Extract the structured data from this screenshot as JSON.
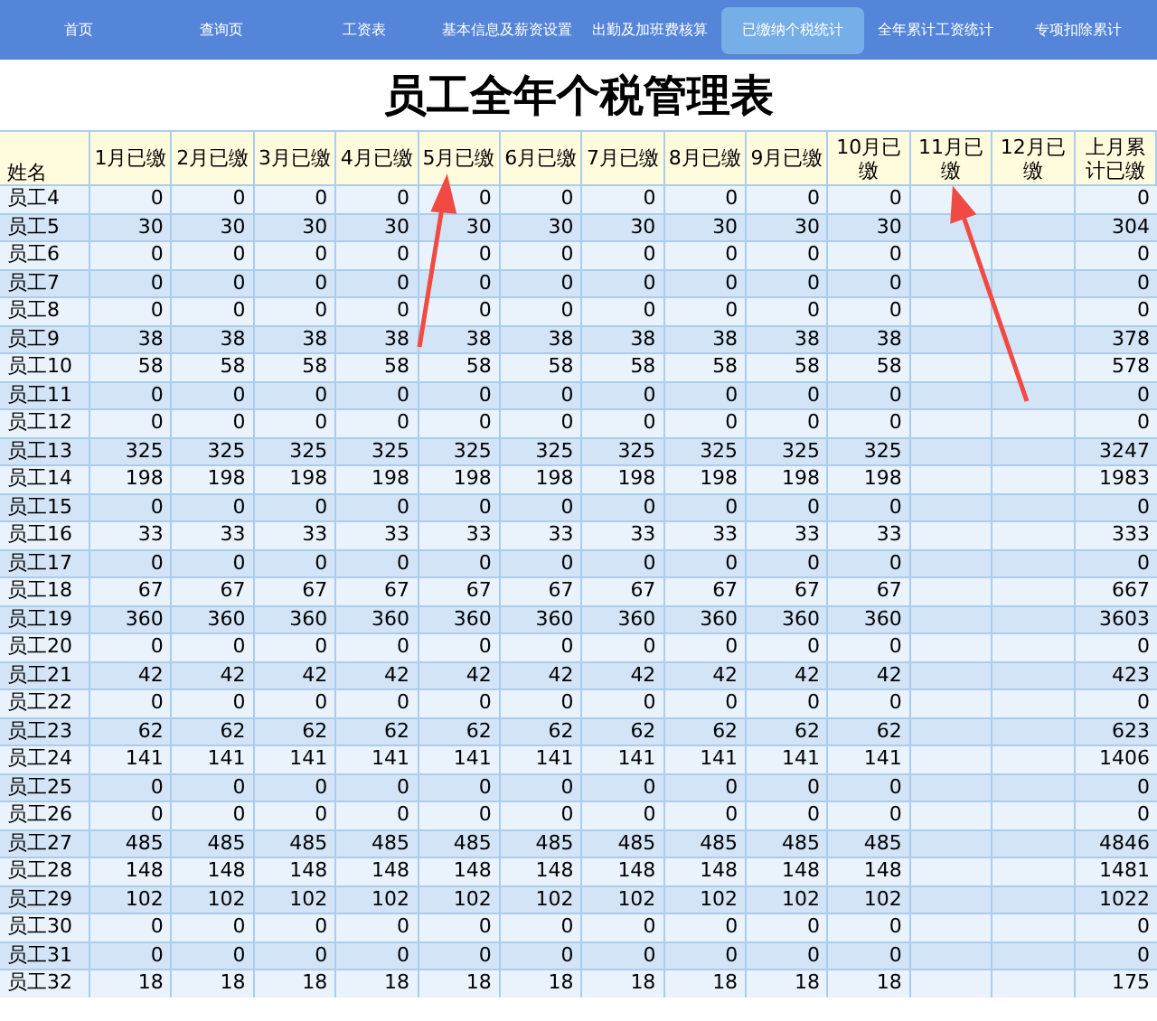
{
  "nav": [
    {
      "label": "首页",
      "selected": false
    },
    {
      "label": "查询页",
      "selected": false
    },
    {
      "label": "工资表",
      "selected": false
    },
    {
      "label": "基本信息及薪资设置",
      "selected": false
    },
    {
      "label": "出勤及加班费核算",
      "selected": false
    },
    {
      "label": "已缴纳个税统计",
      "selected": true
    },
    {
      "label": "全年累计工资统计",
      "selected": false
    },
    {
      "label": "专项扣除累计",
      "selected": false
    }
  ],
  "title": "员工全年个税管理表",
  "table": {
    "columns": [
      "姓名",
      "1月已缴",
      "2月已缴",
      "3月已缴",
      "4月已缴",
      "5月已缴",
      "6月已缴",
      "7月已缴",
      "8月已缴",
      "9月已缴",
      "10月已缴",
      "11月已缴",
      "12月已缴",
      "上月累计已缴"
    ],
    "rows": [
      {
        "name": "员工4",
        "paid": [
          "0",
          "0",
          "0",
          "0",
          "0",
          "0",
          "0",
          "0",
          "0",
          "0"
        ],
        "total": "0"
      },
      {
        "name": "员工5",
        "paid": [
          "30",
          "30",
          "30",
          "30",
          "30",
          "30",
          "30",
          "30",
          "30",
          "30"
        ],
        "total": "304"
      },
      {
        "name": "员工6",
        "paid": [
          "0",
          "0",
          "0",
          "0",
          "0",
          "0",
          "0",
          "0",
          "0",
          "0"
        ],
        "total": "0"
      },
      {
        "name": "员工7",
        "paid": [
          "0",
          "0",
          "0",
          "0",
          "0",
          "0",
          "0",
          "0",
          "0",
          "0"
        ],
        "total": "0"
      },
      {
        "name": "员工8",
        "paid": [
          "0",
          "0",
          "0",
          "0",
          "0",
          "0",
          "0",
          "0",
          "0",
          "0"
        ],
        "total": "0"
      },
      {
        "name": "员工9",
        "paid": [
          "38",
          "38",
          "38",
          "38",
          "38",
          "38",
          "38",
          "38",
          "38",
          "38"
        ],
        "total": "378"
      },
      {
        "name": "员工10",
        "paid": [
          "58",
          "58",
          "58",
          "58",
          "58",
          "58",
          "58",
          "58",
          "58",
          "58"
        ],
        "total": "578"
      },
      {
        "name": "员工11",
        "paid": [
          "0",
          "0",
          "0",
          "0",
          "0",
          "0",
          "0",
          "0",
          "0",
          "0"
        ],
        "total": "0"
      },
      {
        "name": "员工12",
        "paid": [
          "0",
          "0",
          "0",
          "0",
          "0",
          "0",
          "0",
          "0",
          "0",
          "0"
        ],
        "total": "0"
      },
      {
        "name": "员工13",
        "paid": [
          "325",
          "325",
          "325",
          "325",
          "325",
          "325",
          "325",
          "325",
          "325",
          "325"
        ],
        "total": "3247"
      },
      {
        "name": "员工14",
        "paid": [
          "198",
          "198",
          "198",
          "198",
          "198",
          "198",
          "198",
          "198",
          "198",
          "198"
        ],
        "total": "1983"
      },
      {
        "name": "员工15",
        "paid": [
          "0",
          "0",
          "0",
          "0",
          "0",
          "0",
          "0",
          "0",
          "0",
          "0"
        ],
        "total": "0"
      },
      {
        "name": "员工16",
        "paid": [
          "33",
          "33",
          "33",
          "33",
          "33",
          "33",
          "33",
          "33",
          "33",
          "33"
        ],
        "total": "333"
      },
      {
        "name": "员工17",
        "paid": [
          "0",
          "0",
          "0",
          "0",
          "0",
          "0",
          "0",
          "0",
          "0",
          "0"
        ],
        "total": "0"
      },
      {
        "name": "员工18",
        "paid": [
          "67",
          "67",
          "67",
          "67",
          "67",
          "67",
          "67",
          "67",
          "67",
          "67"
        ],
        "total": "667"
      },
      {
        "name": "员工19",
        "paid": [
          "360",
          "360",
          "360",
          "360",
          "360",
          "360",
          "360",
          "360",
          "360",
          "360"
        ],
        "total": "3603"
      },
      {
        "name": "员工20",
        "paid": [
          "0",
          "0",
          "0",
          "0",
          "0",
          "0",
          "0",
          "0",
          "0",
          "0"
        ],
        "total": "0"
      },
      {
        "name": "员工21",
        "paid": [
          "42",
          "42",
          "42",
          "42",
          "42",
          "42",
          "42",
          "42",
          "42",
          "42"
        ],
        "total": "423"
      },
      {
        "name": "员工22",
        "paid": [
          "0",
          "0",
          "0",
          "0",
          "0",
          "0",
          "0",
          "0",
          "0",
          "0"
        ],
        "total": "0"
      },
      {
        "name": "员工23",
        "paid": [
          "62",
          "62",
          "62",
          "62",
          "62",
          "62",
          "62",
          "62",
          "62",
          "62"
        ],
        "total": "623"
      },
      {
        "name": "员工24",
        "paid": [
          "141",
          "141",
          "141",
          "141",
          "141",
          "141",
          "141",
          "141",
          "141",
          "141"
        ],
        "total": "1406"
      },
      {
        "name": "员工25",
        "paid": [
          "0",
          "0",
          "0",
          "0",
          "0",
          "0",
          "0",
          "0",
          "0",
          "0"
        ],
        "total": "0"
      },
      {
        "name": "员工26",
        "paid": [
          "0",
          "0",
          "0",
          "0",
          "0",
          "0",
          "0",
          "0",
          "0",
          "0"
        ],
        "total": "0"
      },
      {
        "name": "员工27",
        "paid": [
          "485",
          "485",
          "485",
          "485",
          "485",
          "485",
          "485",
          "485",
          "485",
          "485"
        ],
        "total": "4846"
      },
      {
        "name": "员工28",
        "paid": [
          "148",
          "148",
          "148",
          "148",
          "148",
          "148",
          "148",
          "148",
          "148",
          "148"
        ],
        "total": "1481"
      },
      {
        "name": "员工29",
        "paid": [
          "102",
          "102",
          "102",
          "102",
          "102",
          "102",
          "102",
          "102",
          "102",
          "102"
        ],
        "total": "1022"
      },
      {
        "name": "员工30",
        "paid": [
          "0",
          "0",
          "0",
          "0",
          "0",
          "0",
          "0",
          "0",
          "0",
          "0"
        ],
        "total": "0"
      },
      {
        "name": "员工31",
        "paid": [
          "0",
          "0",
          "0",
          "0",
          "0",
          "0",
          "0",
          "0",
          "0",
          "0"
        ],
        "total": "0"
      },
      {
        "name": "员工32",
        "paid": [
          "18",
          "18",
          "18",
          "18",
          "18",
          "18",
          "18",
          "18",
          "18",
          "18"
        ],
        "total": "175"
      }
    ]
  }
}
